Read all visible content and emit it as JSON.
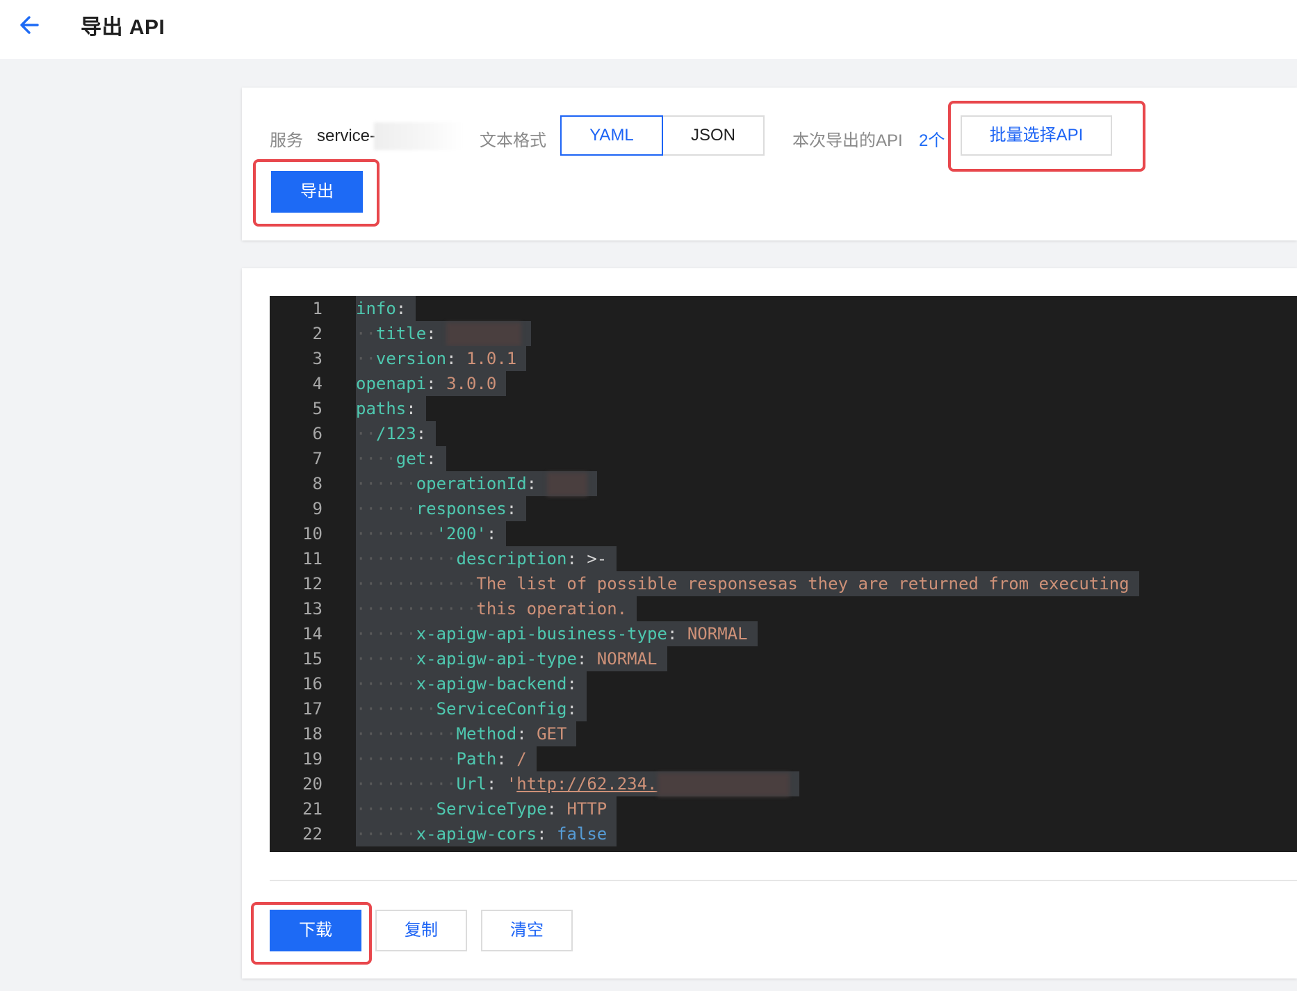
{
  "header": {
    "title": "导出 API"
  },
  "form": {
    "service_label": "服务",
    "service_value": "service-",
    "format_label": "文本格式",
    "format_options": [
      "YAML",
      "JSON"
    ],
    "format_selected": "YAML",
    "count_label": "本次导出的API",
    "count_value": "2个",
    "batch_select_label": "批量选择API",
    "export_label": "导出"
  },
  "editor": {
    "line_numbers": [
      "1",
      "2",
      "3",
      "4",
      "5",
      "6",
      "7",
      "8",
      "9",
      "10",
      "11",
      "12",
      "13",
      "14",
      "15",
      "16",
      "17",
      "18",
      "19",
      "20",
      "21",
      "22"
    ],
    "lines": {
      "l1": "info",
      "l2": "title",
      "l3_key": "version",
      "l3_val": "1.0.1",
      "l4_key": "openapi",
      "l4_val": "3.0.0",
      "l5": "paths",
      "l6": "/123",
      "l7": "get",
      "l8": "operationId",
      "l9": "responses",
      "l10": "'200'",
      "l11_key": "description",
      "l11_val": ">-",
      "l12": "The list of possible responsesas they are returned from executing",
      "l13": "this operation.",
      "l14_key": "x-apigw-api-business-type",
      "l14_val": "NORMAL",
      "l15_key": "x-apigw-api-type",
      "l15_val": "NORMAL",
      "l16": "x-apigw-backend",
      "l17": "ServiceConfig",
      "l18_key": "Method",
      "l18_val": "GET",
      "l19_key": "Path",
      "l19_val": "/",
      "l20_key": "Url",
      "l20_quote": "'",
      "l20_val": "http://62.234.",
      "l21_key": "ServiceType",
      "l21_val": "HTTP",
      "l22_key": "x-apigw-cors",
      "l22_val": "false"
    }
  },
  "actions": {
    "download_label": "下载",
    "copy_label": "复制",
    "clear_label": "清空"
  },
  "colors": {
    "primary": "#1d6af5",
    "highlight_border": "#e8474c",
    "yaml_key": "#4ec9b0",
    "yaml_string": "#ce9178",
    "yaml_bool": "#569cd6"
  }
}
